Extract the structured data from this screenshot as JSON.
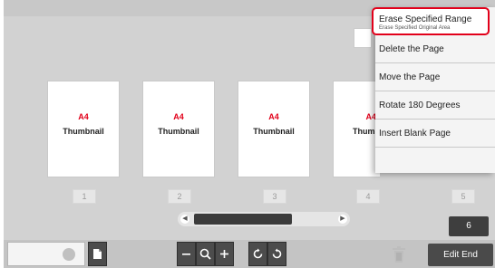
{
  "thumbnails": [
    {
      "size": "A4",
      "label": "Thumbnail",
      "number": "1"
    },
    {
      "size": "A4",
      "label": "Thumbnail",
      "number": "2"
    },
    {
      "size": "A4",
      "label": "Thumbnail",
      "number": "3"
    },
    {
      "size": "A4",
      "label": "Thumb",
      "number": "4"
    },
    {
      "size": "",
      "label": "",
      "number": "5"
    }
  ],
  "page_indicator": "6",
  "edit_end_label": "Edit End",
  "menu": {
    "items": [
      {
        "label": "Erase Specified Range",
        "sub": "Erase Specified Original Area"
      },
      {
        "label": "Delete the Page"
      },
      {
        "label": "Move the Page"
      },
      {
        "label": "Rotate 180 Degrees"
      },
      {
        "label": "Insert Blank Page"
      }
    ]
  },
  "icons": [
    "zoom-out-icon",
    "magnifier-icon",
    "zoom-in-icon",
    "rotate-left-icon",
    "rotate-right-icon",
    "trash-icon",
    "page-icon"
  ],
  "colors": {
    "size_label": "#e2001a",
    "menu_highlight": "#e2001a"
  }
}
